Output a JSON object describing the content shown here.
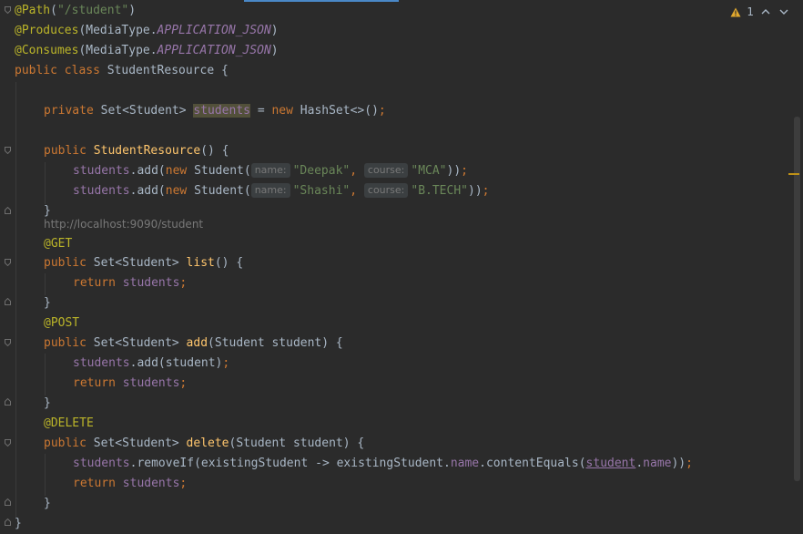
{
  "editor": {
    "inspection": {
      "warning_count": "1"
    },
    "url_hint": "http://localhost:9090/student",
    "lines": {
      "l1": {
        "a": "@Path",
        "b": "(",
        "c": "\"/student\"",
        "d": ")"
      },
      "l2": {
        "a": "@Produces",
        "b": "(MediaType.",
        "c": "APPLICATION_JSON",
        "d": ")"
      },
      "l3": {
        "a": "@Consumes",
        "b": "(MediaType.",
        "c": "APPLICATION_JSON",
        "d": ")"
      },
      "l4": {
        "a": "public class ",
        "b": "StudentResource {"
      },
      "l5": {
        "a": "private ",
        "b": "Set<Student> ",
        "c": "students",
        "d": " = ",
        "e": "new ",
        "f": "HashSet<>()",
        "g": ";"
      },
      "l6": {
        "a": "public ",
        "b": "StudentResource",
        "c": "() {"
      },
      "l7": {
        "a": "students",
        "b": ".add(",
        "c": "new ",
        "d": "Student(",
        "hint1": "name:",
        "e": "\"Deepak\"",
        "f": ", ",
        "hint2": "course:",
        "g": "\"MCA\"",
        "h": "))",
        "i": ";"
      },
      "l8": {
        "a": "students",
        "b": ".add(",
        "c": "new ",
        "d": "Student(",
        "hint1": "name:",
        "e": "\"Shashi\"",
        "f": ", ",
        "hint2": "course:",
        "g": "\"B.TECH\"",
        "h": "))",
        "i": ";"
      },
      "l9": {
        "a": "}"
      },
      "l10": {
        "a": "@GET"
      },
      "l11": {
        "a": "public ",
        "b": "Set<Student> ",
        "c": "list",
        "d": "() {"
      },
      "l12": {
        "a": "return ",
        "b": "students",
        "c": ";"
      },
      "l13": {
        "a": "}"
      },
      "l14": {
        "a": "@POST"
      },
      "l15": {
        "a": "public ",
        "b": "Set<Student> ",
        "c": "add",
        "d": "(Student student) {"
      },
      "l16": {
        "a": "students",
        "b": ".add(student)",
        "c": ";"
      },
      "l17": {
        "a": "return ",
        "b": "students",
        "c": ";"
      },
      "l18": {
        "a": "}"
      },
      "l19": {
        "a": "@DELETE"
      },
      "l20": {
        "a": "public ",
        "b": "Set<Student> ",
        "c": "delete",
        "d": "(Student student) {"
      },
      "l21": {
        "a": "students",
        "b": ".removeIf(existingStudent -> existingStudent.",
        "c": "name",
        "d": ".contentEquals(",
        "e": "student",
        "f": ".",
        "g": "name",
        "h": "))",
        "i": ";"
      },
      "l22": {
        "a": "return ",
        "b": "students",
        "c": ";"
      },
      "l23": {
        "a": "}"
      },
      "l24": {
        "a": "}"
      }
    }
  },
  "colors": {
    "background": "#2b2b2b",
    "keyword": "#cc7832",
    "string": "#6a8759",
    "annotation": "#bbb529",
    "field": "#9876aa",
    "method": "#ffc66d",
    "text": "#a9b7c6"
  },
  "icons": {
    "warning": "warning-icon",
    "up": "chevron-up-icon",
    "down": "chevron-down-icon",
    "fold": "fold-icon"
  }
}
